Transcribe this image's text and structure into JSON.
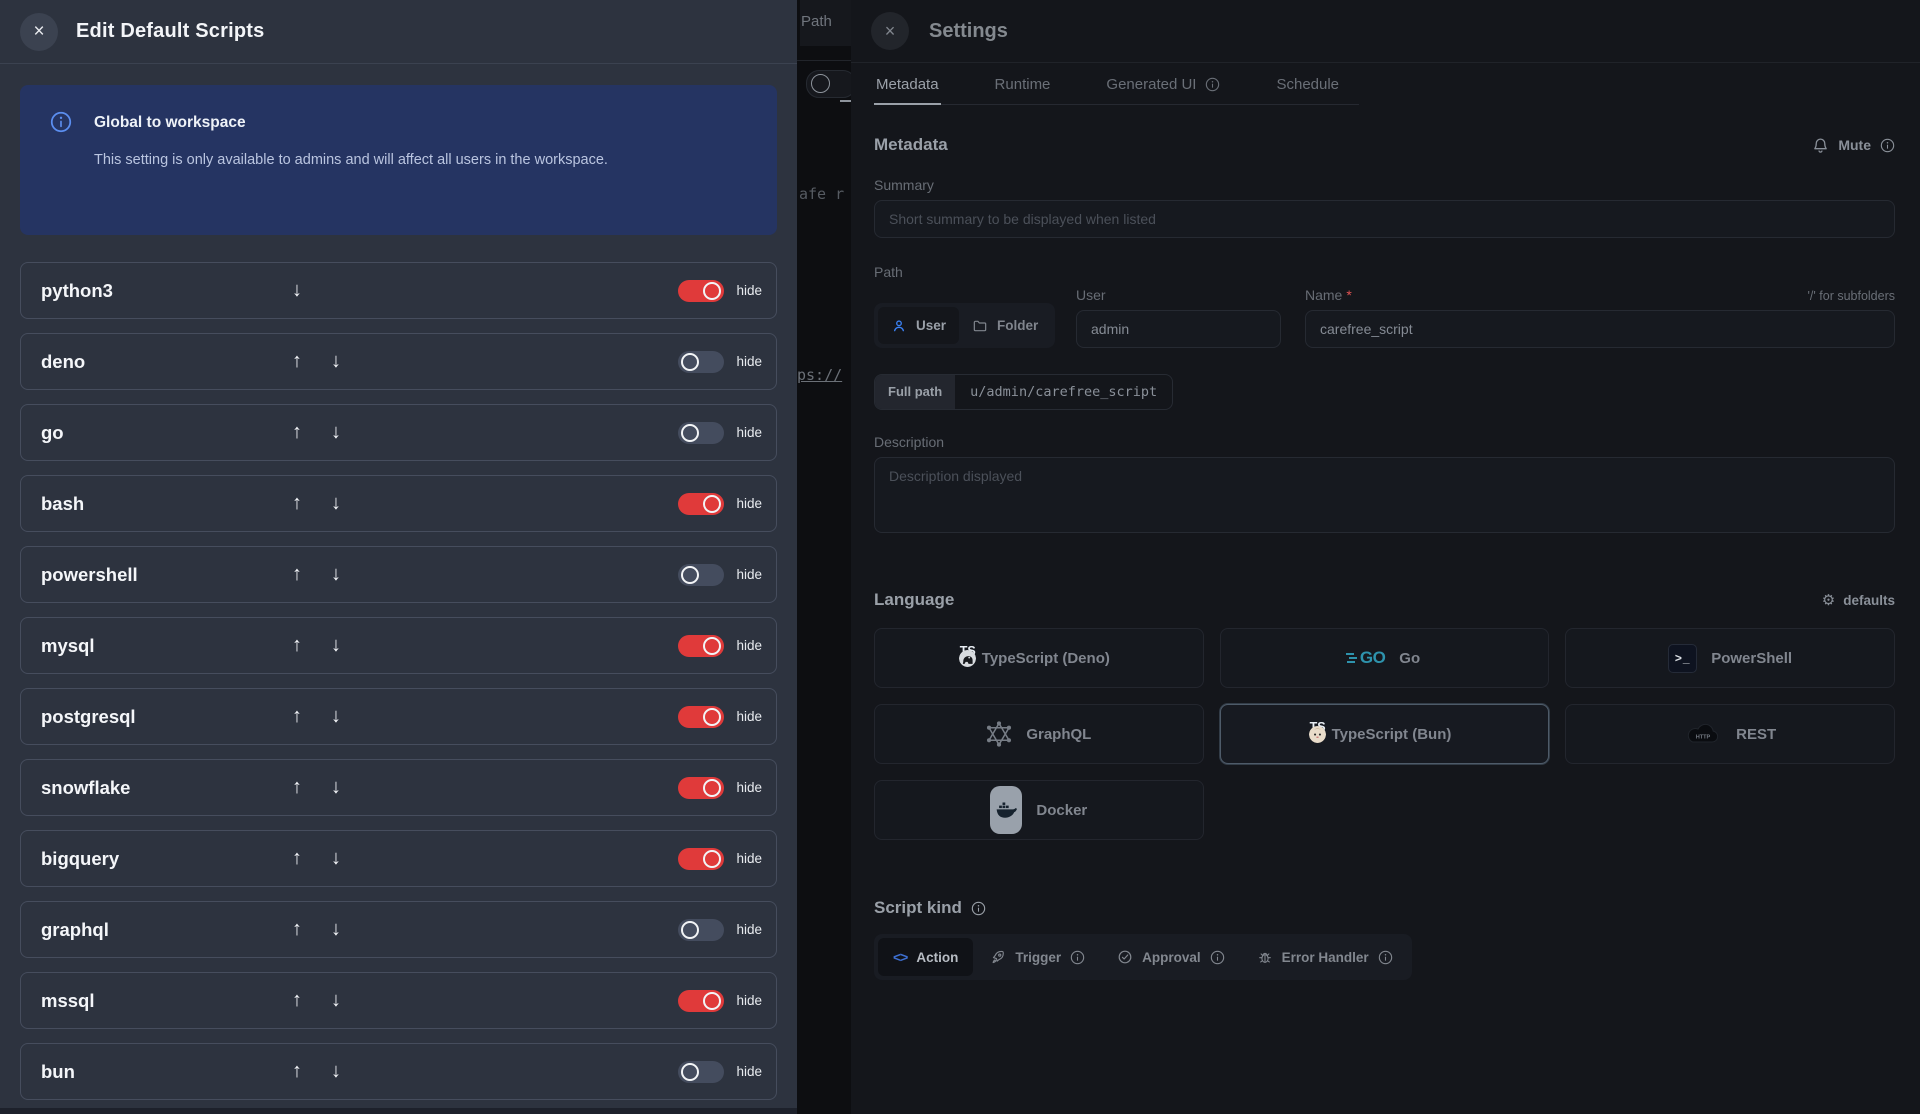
{
  "background": {
    "path_label": "Path",
    "code_fragment": "afe r",
    "link_fragment": "ps://"
  },
  "left_panel": {
    "title": "Edit Default Scripts",
    "notice": {
      "title": "Global to workspace",
      "body": "This setting is only available to admins and will affect all users in the workspace."
    },
    "hide_label": "hide",
    "icons": {
      "close": "close-icon",
      "move_up": "arrow-up-icon",
      "move_down": "arrow-down-icon"
    },
    "rows": [
      {
        "name": "python3",
        "up": false,
        "down": true,
        "hidden": true
      },
      {
        "name": "deno",
        "up": true,
        "down": true,
        "hidden": false
      },
      {
        "name": "go",
        "up": true,
        "down": true,
        "hidden": false
      },
      {
        "name": "bash",
        "up": true,
        "down": true,
        "hidden": true
      },
      {
        "name": "powershell",
        "up": true,
        "down": true,
        "hidden": false
      },
      {
        "name": "mysql",
        "up": true,
        "down": true,
        "hidden": true
      },
      {
        "name": "postgresql",
        "up": true,
        "down": true,
        "hidden": true
      },
      {
        "name": "snowflake",
        "up": true,
        "down": true,
        "hidden": true
      },
      {
        "name": "bigquery",
        "up": true,
        "down": true,
        "hidden": true
      },
      {
        "name": "graphql",
        "up": true,
        "down": true,
        "hidden": false
      },
      {
        "name": "mssql",
        "up": true,
        "down": true,
        "hidden": true
      },
      {
        "name": "bun",
        "up": true,
        "down": true,
        "hidden": false
      }
    ],
    "toggle_on_color": "#e03a3a",
    "notice_bg_color": "#253462"
  },
  "settings_panel": {
    "title": "Settings",
    "tabs": [
      {
        "label": "Metadata",
        "active": true,
        "info": false
      },
      {
        "label": "Runtime",
        "active": false,
        "info": false
      },
      {
        "label": "Generated UI",
        "active": false,
        "info": true
      },
      {
        "label": "Schedule",
        "active": false,
        "info": false
      }
    ],
    "metadata": {
      "heading": "Metadata",
      "mute_label": "Mute",
      "summary_label": "Summary",
      "summary_placeholder": "Short summary to be displayed when listed",
      "path_label": "Path",
      "owner_toggle": {
        "user": "User",
        "folder": "Folder"
      },
      "user_label": "User",
      "user_value": "admin",
      "name_label": "Name",
      "name_required": "*",
      "name_value": "carefree_script",
      "subfolder_hint": "'/' for subfolders",
      "full_path_label": "Full path",
      "full_path_value": "u/admin/carefree_script",
      "description_label": "Description",
      "description_placeholder": "Description displayed"
    },
    "language": {
      "heading": "Language",
      "defaults_label": "defaults",
      "options": [
        {
          "label": "TypeScript (Deno)",
          "icon": "typescript-deno-icon",
          "selected": false
        },
        {
          "label": "Go",
          "icon": "go-icon",
          "selected": false
        },
        {
          "label": "PowerShell",
          "icon": "powershell-icon",
          "selected": false
        },
        {
          "label": "GraphQL",
          "icon": "graphql-icon",
          "selected": false
        },
        {
          "label": "TypeScript (Bun)",
          "icon": "typescript-bun-icon",
          "selected": true
        },
        {
          "label": "REST",
          "icon": "rest-cloud-icon",
          "selected": false
        },
        {
          "label": "Docker",
          "icon": "docker-icon",
          "selected": false
        }
      ]
    },
    "script_kind": {
      "heading": "Script kind",
      "heading_info": true,
      "options": [
        {
          "label": "Action",
          "icon": "code-icon",
          "selected": true,
          "info": false
        },
        {
          "label": "Trigger",
          "icon": "rocket-icon",
          "selected": false,
          "info": true
        },
        {
          "label": "Approval",
          "icon": "check-circle-icon",
          "selected": false,
          "info": true
        },
        {
          "label": "Error Handler",
          "icon": "bug-icon",
          "selected": false,
          "info": true
        }
      ]
    },
    "accent_blue": "#3b82f6"
  }
}
